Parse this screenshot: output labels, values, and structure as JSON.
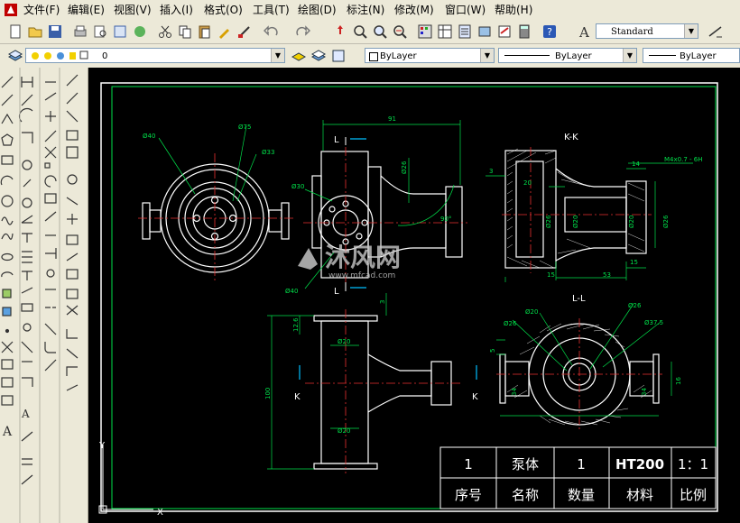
{
  "menu": [
    "文件(F)",
    "编辑(E)",
    "视图(V)",
    "插入(I)",
    "格式(O)",
    "工具(T)",
    "绘图(D)",
    "标注(N)",
    "修改(M)",
    "窗口(W)",
    "帮助(H)"
  ],
  "toolbar": {
    "text_style": "Standard",
    "layer": "0",
    "color": "ByLayer",
    "linetype": "ByLayer",
    "lineweight": "ByLayer"
  },
  "drawing": {
    "view_kk": "K-K",
    "view_ll": "L-L",
    "section_l": "L",
    "section_k": "K",
    "dims": {
      "d40_a": "Ø40",
      "d75": "Ø75",
      "d33": "Ø33",
      "d30": "Ø30",
      "d40_b": "Ø40",
      "d26_a": "Ø26",
      "d91": "91",
      "angle90": "90°",
      "d4_3": "3",
      "thread": "M4x0.7 - 6H",
      "d14": "14",
      "d20_a": "20",
      "d26_b": "Ø26",
      "d20_b": "Ø20",
      "d20_c": "Ø20",
      "d26_c": "Ø26",
      "d15_a": "15",
      "d53": "53",
      "d15_b": "15",
      "d12_6": "12.6",
      "d3": "3",
      "d20_d": "Ø20",
      "d100": "100",
      "d20_e": "Ø20",
      "d26_d": "Ø26",
      "d20_f": "Ø20",
      "d26_e": "Ø26",
      "d37_5": "Ø37.5",
      "d5": "5",
      "d34": "34",
      "d16": "16"
    },
    "watermark_cn": "沐风网",
    "watermark_url": "www.mfcad.com"
  },
  "title_block": {
    "row1": [
      "1",
      "泵体",
      "1",
      "HT200",
      "1：1"
    ],
    "row2": [
      "序号",
      "名称",
      "数量",
      "材料",
      "比例"
    ]
  },
  "ucs": {
    "y": "Y",
    "x": "X"
  }
}
